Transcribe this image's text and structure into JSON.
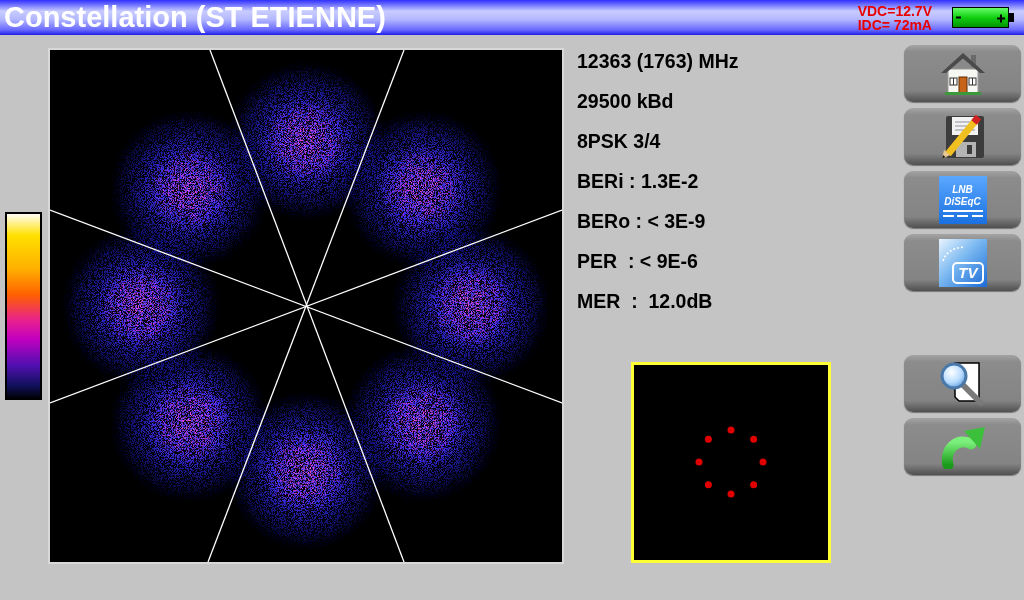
{
  "title_bar": {
    "title": "Constellation (ST ETIENNE)",
    "voltage": "VDC=12.7V",
    "current": "IDC= 72mA"
  },
  "measurements": [
    "12363 (1763) MHz",
    "29500 kBd",
    "8PSK 3/4",
    "BERi : 1.3E-2",
    "BERo : < 3E-9",
    "PER  : < 9E-6",
    "MER  :  12.0dB"
  ],
  "side_buttons": [
    {
      "kind": "home"
    },
    {
      "kind": "save"
    },
    {
      "kind": "lnb_diseqc",
      "lines": [
        "LNB",
        "DiSEqC"
      ]
    },
    {
      "kind": "tv",
      "label": "TV"
    }
  ],
  "tool_buttons": [
    {
      "kind": "zoom"
    },
    {
      "kind": "redo"
    }
  ]
}
